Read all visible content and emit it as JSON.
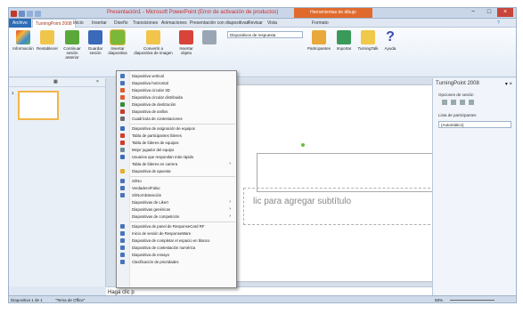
{
  "window": {
    "title": "Presentación1 - Microsoft PowerPoint (Error de activación de productos)",
    "contextual_tab": "Herramientas de dibujo"
  },
  "tabs": [
    "Archivo",
    "TurningPoint 2008",
    "Inicio",
    "Insertar",
    "Diseño",
    "Transiciones",
    "Animaciones",
    "Presentación con diapositivas",
    "Revisar",
    "Vista",
    "Formato"
  ],
  "ribbon": {
    "buttons": [
      "Información",
      "Restablecer",
      "Continuar sesión anterior",
      "Guardar sesión",
      "Insertar diapositiva",
      "Convertir a diapositiva de imagen",
      "Insertar objeto",
      "Participantes",
      "Importar",
      "TurningTalk",
      "Ayuda"
    ],
    "combo_value": "Dispositivos de respuesta"
  },
  "menu": {
    "items": [
      {
        "label": "Diapositiva vertical",
        "color": "#4a74b8"
      },
      {
        "label": "Diapositiva horizontal",
        "color": "#4a74b8"
      },
      {
        "label": "Diapositiva circular 3D",
        "color": "#e05a2a"
      },
      {
        "label": "Diapositiva circular distribuida",
        "color": "#e05a2a"
      },
      {
        "label": "Diapositiva de deslización",
        "color": "#3a8a3a"
      },
      {
        "label": "Diapositiva de anillos",
        "color": "#c83a2a"
      },
      {
        "label": "Cuadrícula de contestaciones",
        "color": "#6a6a6a"
      },
      {
        "sep": true
      },
      {
        "label": "Diapositiva de asignación de equipos",
        "color": "#3a6ab8"
      },
      {
        "label": "Tabla de participantes líderes",
        "color": "#d23a2a"
      },
      {
        "label": "Tabla de líderes de equipos",
        "color": "#d23a2a"
      },
      {
        "label": "Mejor jugador del equipo",
        "color": "#6a8a9a"
      },
      {
        "label": "Usuarios que respondan más rápido",
        "color": "#3a6ab8"
      },
      {
        "label": "Tabla de líderes en carrera",
        "color": "",
        "submenu": true
      },
      {
        "label": "Diapositiva de apuesta",
        "color": "#e0b02a"
      },
      {
        "sep": true
      },
      {
        "label": "Sí/No",
        "color": "#4a74b8"
      },
      {
        "label": "Verdadero/Falso",
        "color": "#4a74b8"
      },
      {
        "label": "Sí/No/Abstención",
        "color": "#4a74b8"
      },
      {
        "label": "Diapositivas de Likert",
        "color": "",
        "submenu": true
      },
      {
        "label": "Diapositivas genéricas",
        "color": "",
        "submenu": true
      },
      {
        "label": "Diapositivas de competición",
        "color": "",
        "submenu": true
      },
      {
        "sep": true
      },
      {
        "label": "Diapositiva de panel de ResponseCard RF",
        "color": "#4a74b8"
      },
      {
        "label": "Inicio de sesión de ResponseWare",
        "color": "#4a74b8"
      },
      {
        "label": "Diapositiva de completar el espacio en blanco",
        "color": "#4a74b8"
      },
      {
        "label": "Diapositiva de contestación numérica",
        "color": "#4a74b8"
      },
      {
        "label": "Diapositiva de ensayo",
        "color": "#4a74b8"
      },
      {
        "label": "Clasificación de prioridades",
        "color": "#4a74b8"
      }
    ]
  },
  "slide": {
    "subtitle_placeholder": "lic para agregar subtítulo",
    "notes_placeholder": "Haga clic p"
  },
  "slides_panel": {
    "thumb_number": "1"
  },
  "turningpoint_panel": {
    "title": "TurningPoint 2008",
    "session_options": "Opciones de sesión",
    "participants_list": "Lista de participantes",
    "participants_value": "(Automático)"
  },
  "status": {
    "slide_info": "Diapositiva 1 de 1",
    "theme": "\"Tema de Office\"",
    "zoom": "69%"
  }
}
